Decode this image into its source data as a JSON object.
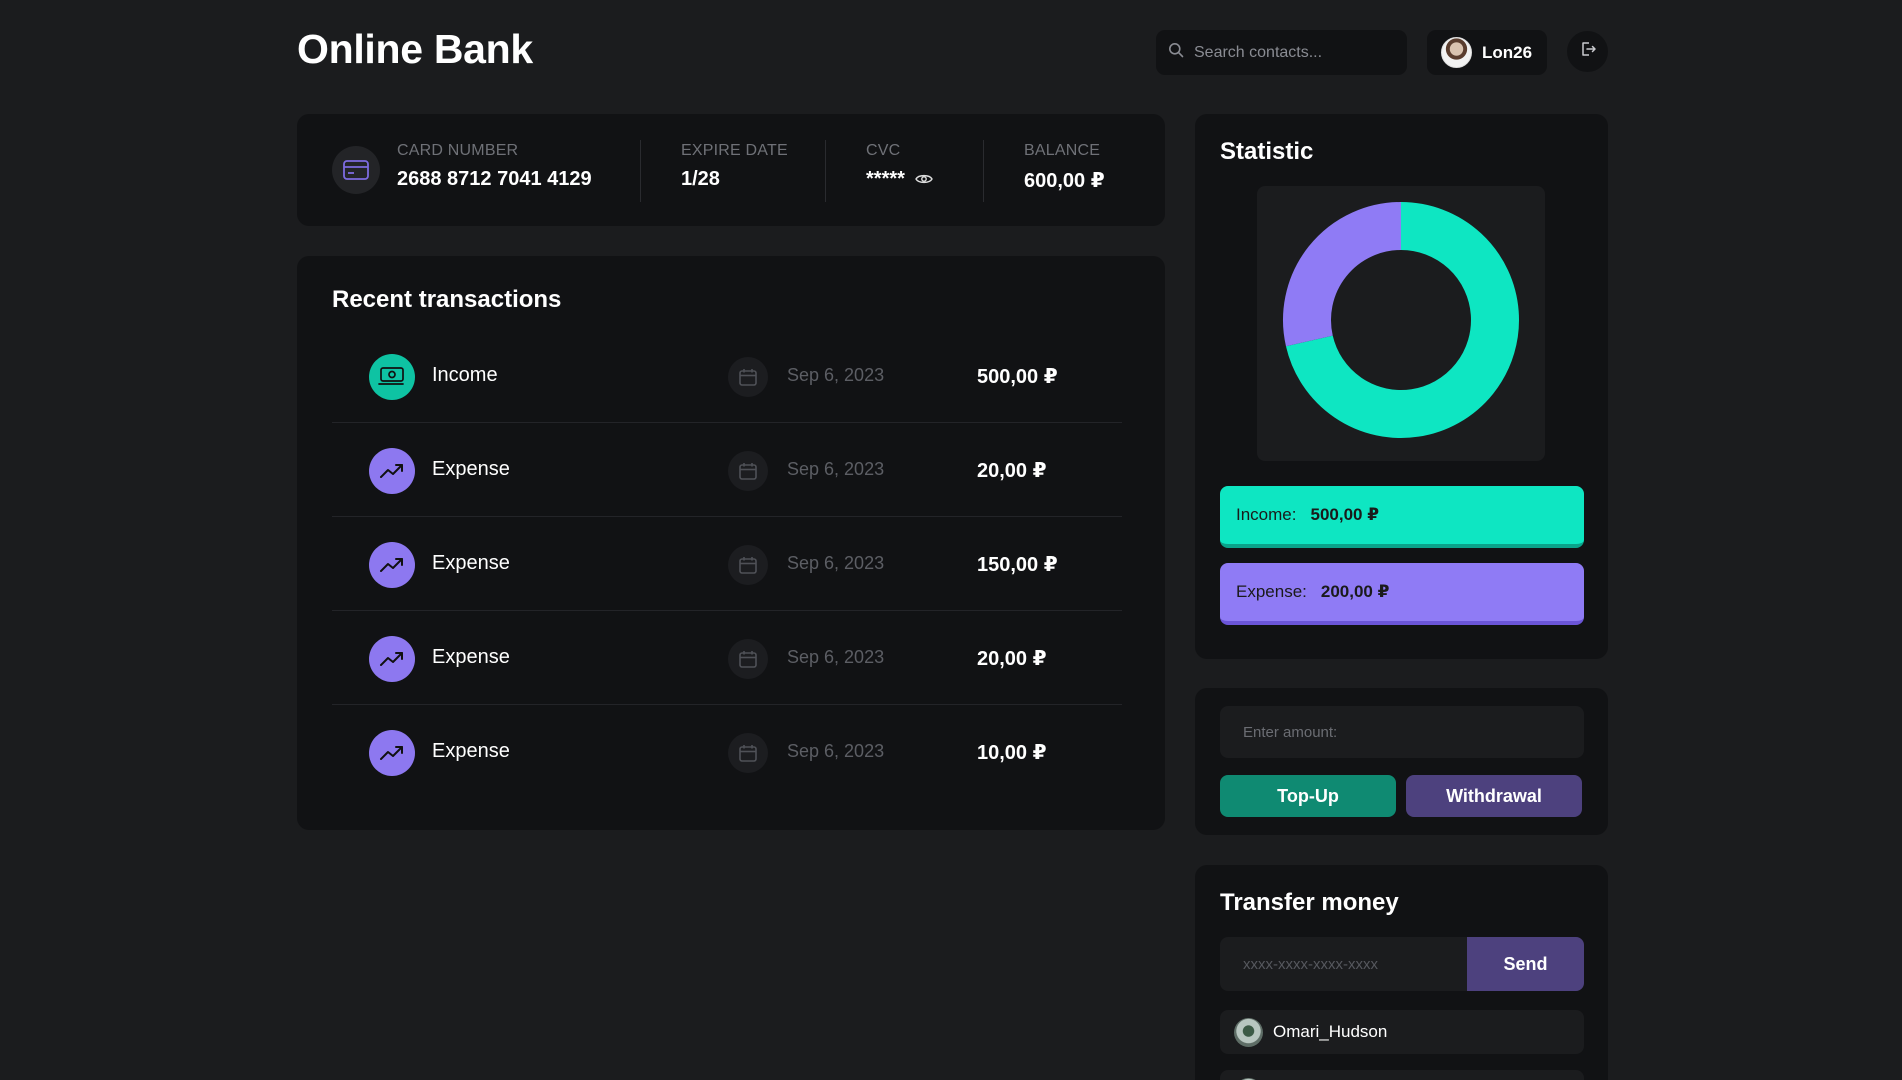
{
  "header": {
    "title": "Online Bank",
    "search_placeholder": "Search contacts...",
    "username": "Lon26"
  },
  "card": {
    "number_label": "CARD NUMBER",
    "number": "2688 8712 7041 4129",
    "expire_label": "EXPIRE DATE",
    "expire": "1/28",
    "cvc_label": "CVC",
    "cvc": "*****",
    "balance_label": "BALANCE",
    "balance": "600,00 ₽"
  },
  "transactions": {
    "title": "Recent transactions",
    "rows": [
      {
        "type": "Income",
        "kind": "income",
        "date": "Sep 6, 2023",
        "amount": "500,00 ₽"
      },
      {
        "type": "Expense",
        "kind": "expense",
        "date": "Sep 6, 2023",
        "amount": "20,00 ₽"
      },
      {
        "type": "Expense",
        "kind": "expense",
        "date": "Sep 6, 2023",
        "amount": "150,00 ₽"
      },
      {
        "type": "Expense",
        "kind": "expense",
        "date": "Sep 6, 2023",
        "amount": "20,00 ₽"
      },
      {
        "type": "Expense",
        "kind": "expense",
        "date": "Sep 6, 2023",
        "amount": "10,00 ₽"
      }
    ]
  },
  "statistic": {
    "title": "Statistic",
    "income_label": "Income:",
    "income_value": "500,00 ₽",
    "expense_label": "Expense:",
    "expense_value": "200,00 ₽"
  },
  "chart_data": {
    "type": "pie",
    "categories": [
      "Income",
      "Expense"
    ],
    "values": [
      500,
      200
    ],
    "colors": [
      "#0ee6c2",
      "#8f7bf5"
    ],
    "title": ""
  },
  "amount": {
    "placeholder": "Enter amount:",
    "topup_label": "Top-Up",
    "withdraw_label": "Withdrawal"
  },
  "transfer": {
    "title": "Transfer money",
    "placeholder": "xxxx-xxxx-xxxx-xxxx",
    "send_label": "Send",
    "contacts": [
      "Omari_Hudson"
    ]
  },
  "colors": {
    "accent_income": "#0ee6c2",
    "accent_expense": "#8f7bf5",
    "background": "#1b1c1e",
    "panel": "#111214"
  },
  "icons": {
    "search": "search-icon",
    "logout": "logout-icon",
    "card": "credit-card-icon",
    "eye": "eye-icon",
    "income": "money-icon",
    "expense": "trending-up-icon",
    "calendar": "calendar-icon"
  }
}
